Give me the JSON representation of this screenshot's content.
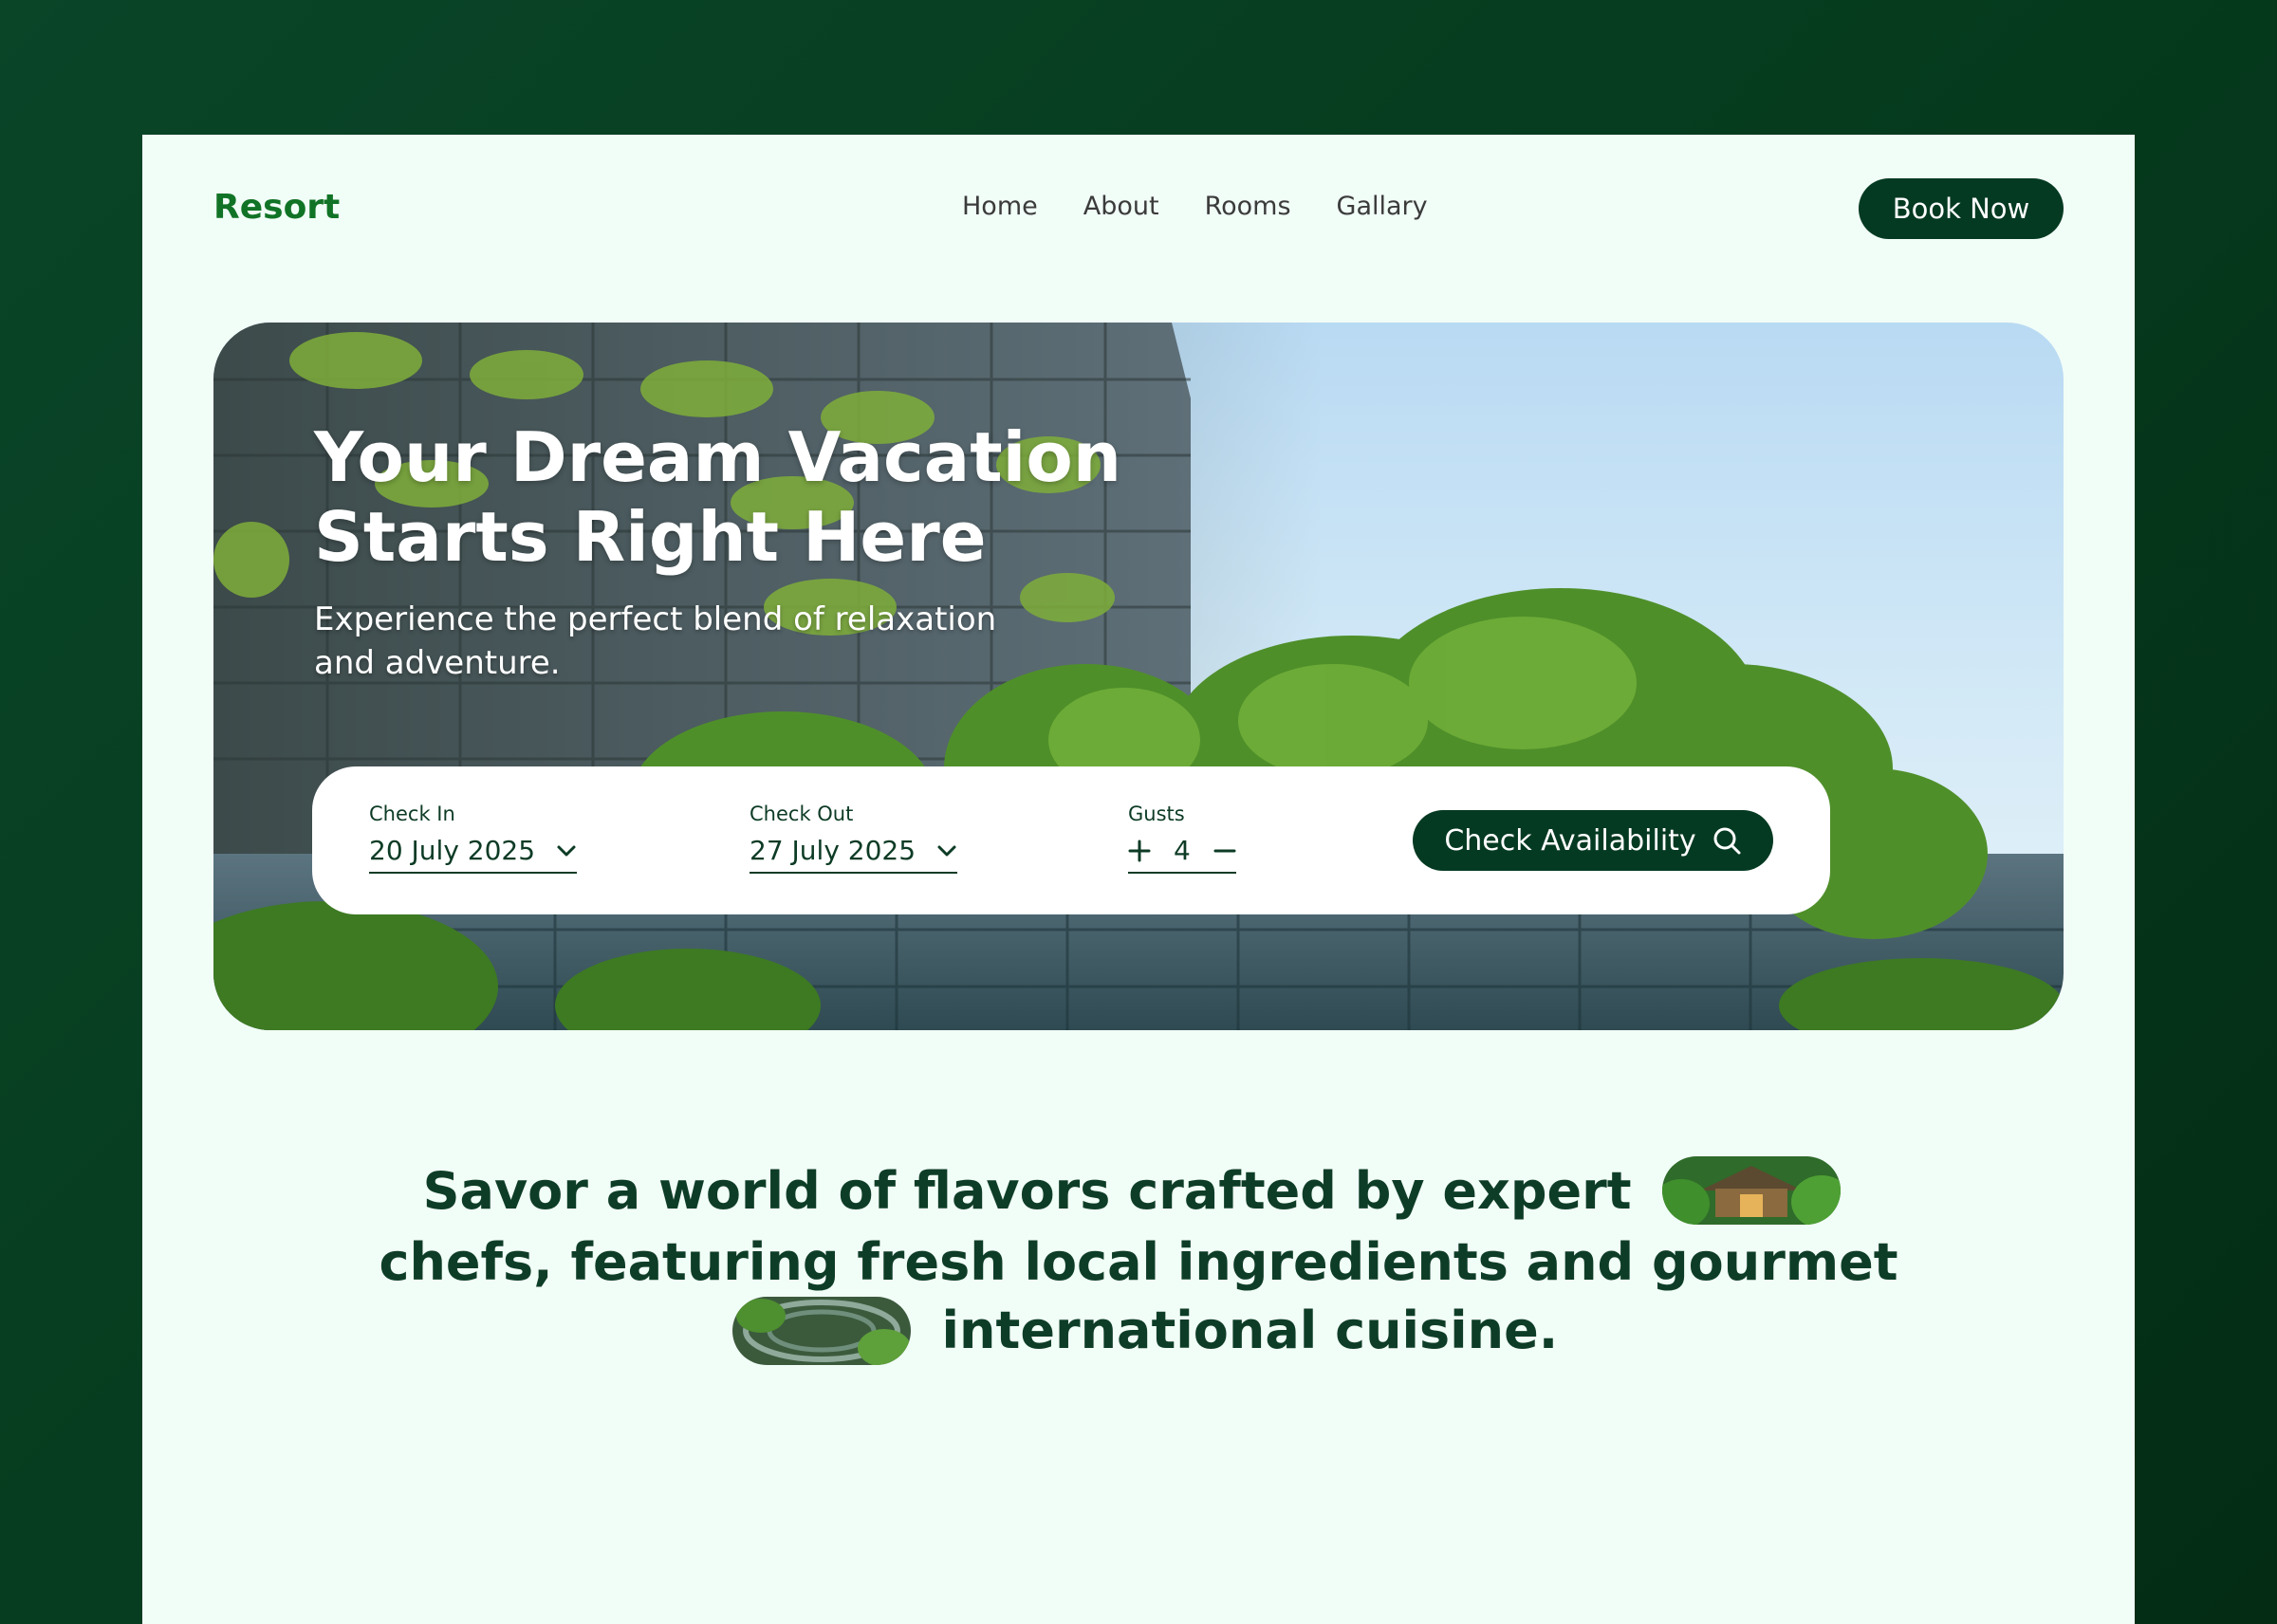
{
  "header": {
    "logo": "Resort",
    "nav": [
      "Home",
      "About",
      "Rooms",
      "Gallary"
    ],
    "book_label": "Book Now"
  },
  "hero": {
    "title": "Your Dream Vacation Starts Right Here",
    "subtitle": "Experience the perfect blend of relaxation and adventure."
  },
  "booking": {
    "check_in_label": "Check In",
    "check_in_value": "20 July 2025",
    "check_out_label": "Check Out",
    "check_out_value": "27 July 2025",
    "guests_label": "Gusts",
    "guests_value": "4",
    "button_label": "Check Availability",
    "icons": {
      "dropdown": "chevron-down-icon",
      "plus": "plus-icon",
      "minus": "minus-icon",
      "search": "search-icon"
    }
  },
  "tagline": {
    "part1": "Savor a world of flavors crafted by expert",
    "part2": "chefs, featuring fresh local ingredients and gourmet",
    "part3": "international cuisine."
  },
  "colors": {
    "background": "#053a1d",
    "page": "#f1fdf7",
    "logo": "#117326",
    "primary": "#053a22",
    "text_dark": "#0e3d27"
  }
}
